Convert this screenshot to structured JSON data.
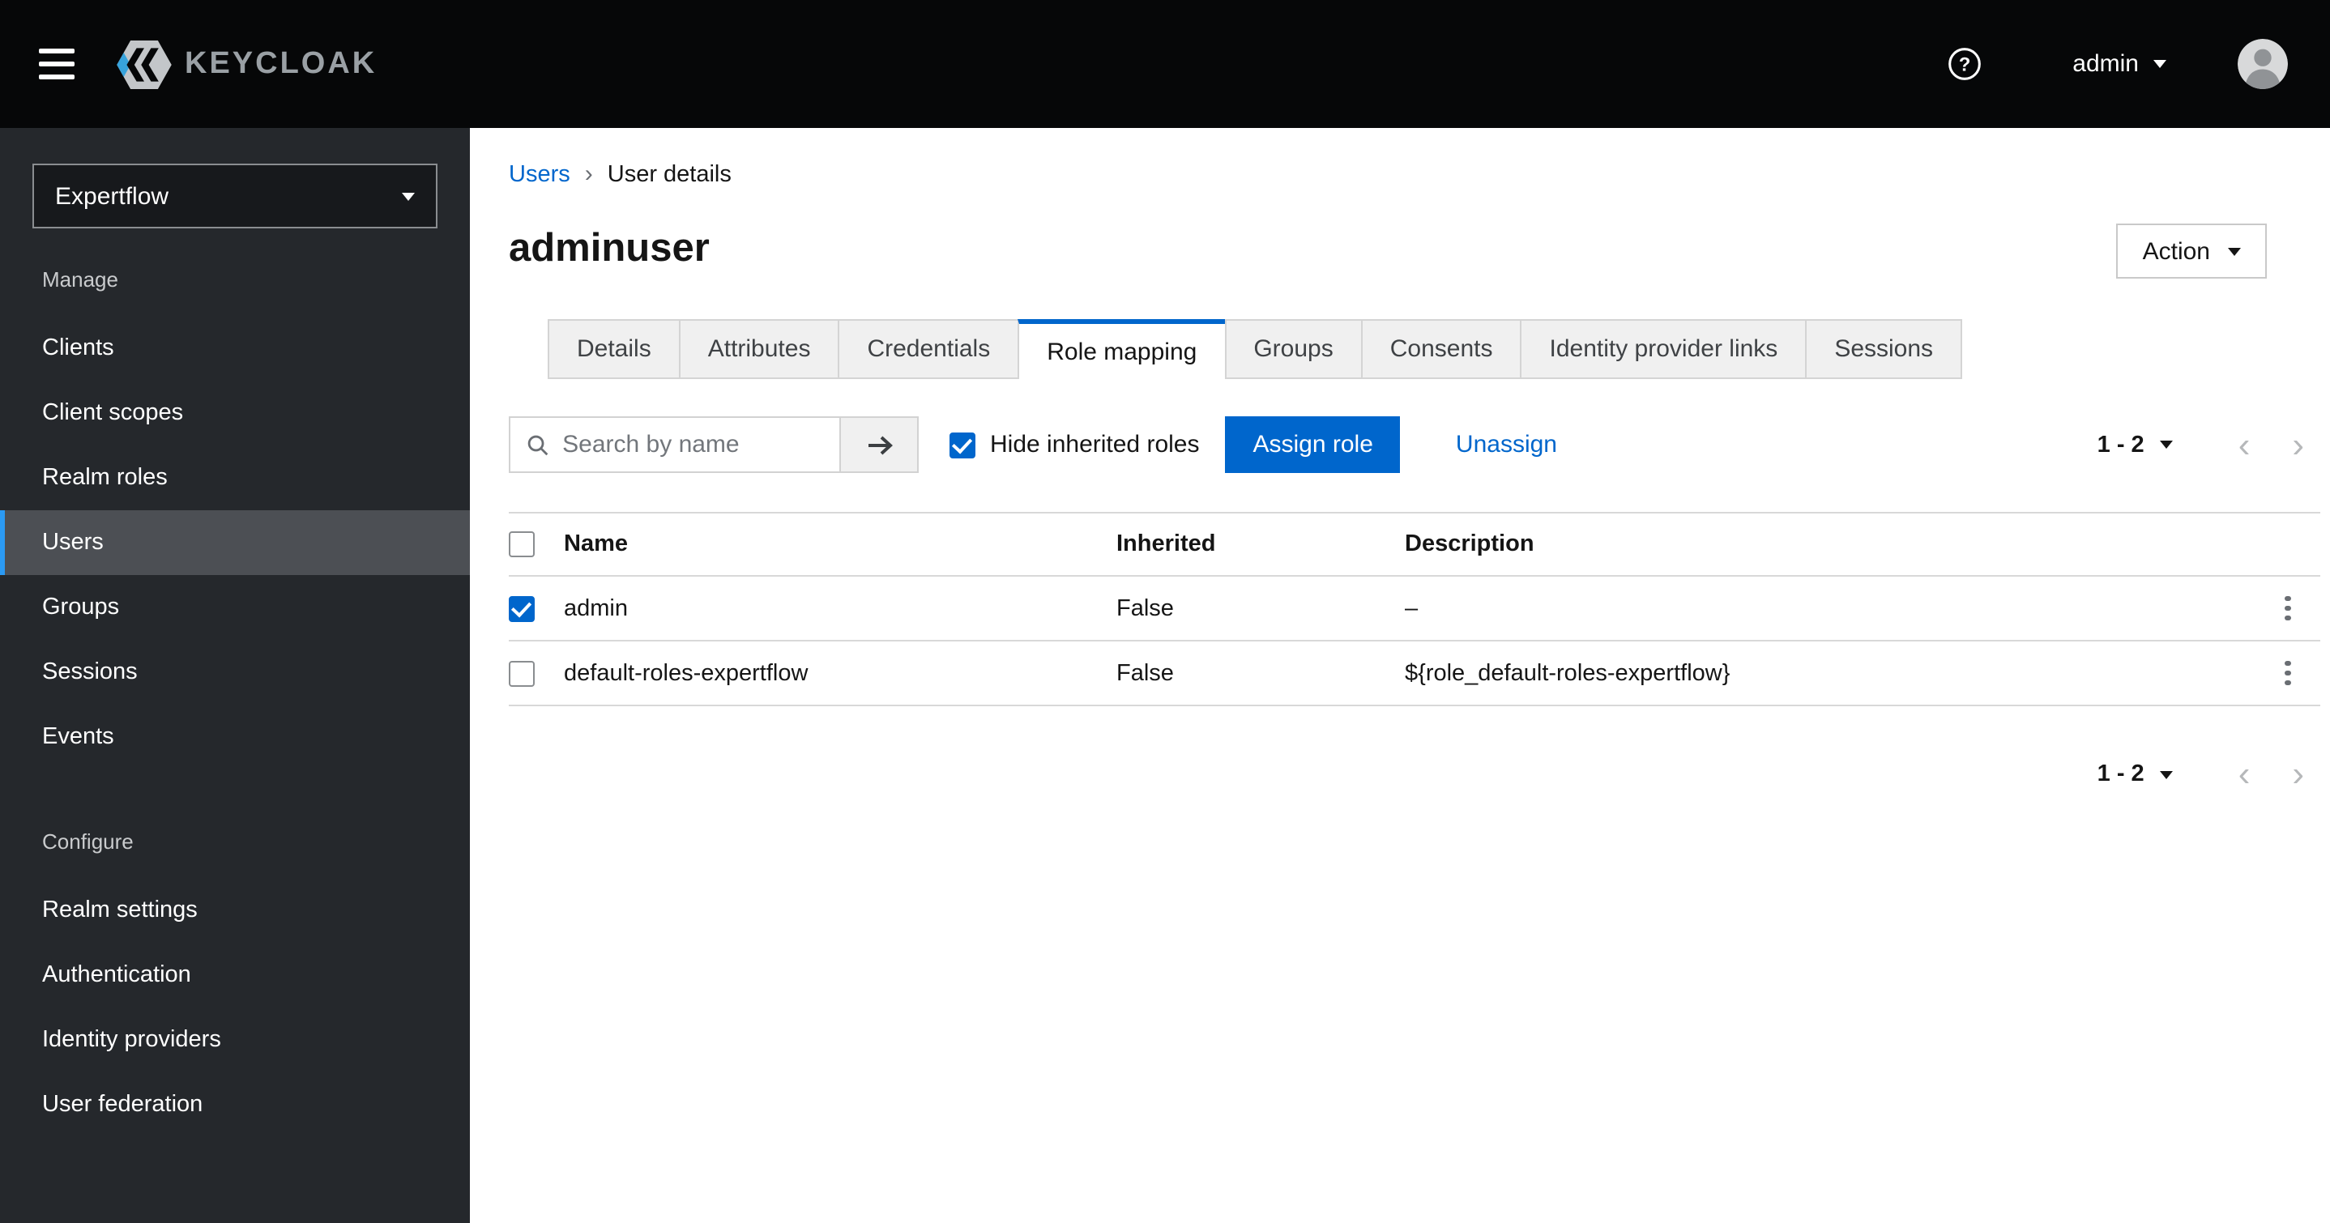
{
  "masthead": {
    "brand": "KEYCLOAK",
    "username": "admin"
  },
  "sidebar": {
    "realm": "Expertflow",
    "active_item": "Users",
    "sections": [
      {
        "label": "Manage",
        "items": [
          "Clients",
          "Client scopes",
          "Realm roles",
          "Users",
          "Groups",
          "Sessions",
          "Events"
        ]
      },
      {
        "label": "Configure",
        "items": [
          "Realm settings",
          "Authentication",
          "Identity providers",
          "User federation"
        ]
      }
    ]
  },
  "breadcrumb": {
    "parent": "Users",
    "current": "User details"
  },
  "page": {
    "title": "adminuser",
    "action_label": "Action"
  },
  "tabs": {
    "items": [
      "Details",
      "Attributes",
      "Credentials",
      "Role mapping",
      "Groups",
      "Consents",
      "Identity provider links",
      "Sessions"
    ],
    "active": "Role mapping"
  },
  "toolbar": {
    "search_placeholder": "Search by name",
    "hide_inherited_label": "Hide inherited roles",
    "hide_inherited_checked": true,
    "assign_label": "Assign role",
    "unassign_label": "Unassign",
    "pagination_label": "1 - 2"
  },
  "table": {
    "columns": [
      "Name",
      "Inherited",
      "Description"
    ],
    "header_checked": false,
    "rows": [
      {
        "checked": true,
        "name": "admin",
        "inherited": "False",
        "description": "–"
      },
      {
        "checked": false,
        "name": "default-roles-expertflow",
        "inherited": "False",
        "description": "${role_default-roles-expertflow}"
      }
    ]
  },
  "icons": {
    "prev": "‹",
    "next": "›",
    "breadcrumb_divider": "›"
  },
  "colors": {
    "accent": "#0066cc",
    "link": "#0066cc",
    "nav_current_accent": "#2b9af3"
  }
}
